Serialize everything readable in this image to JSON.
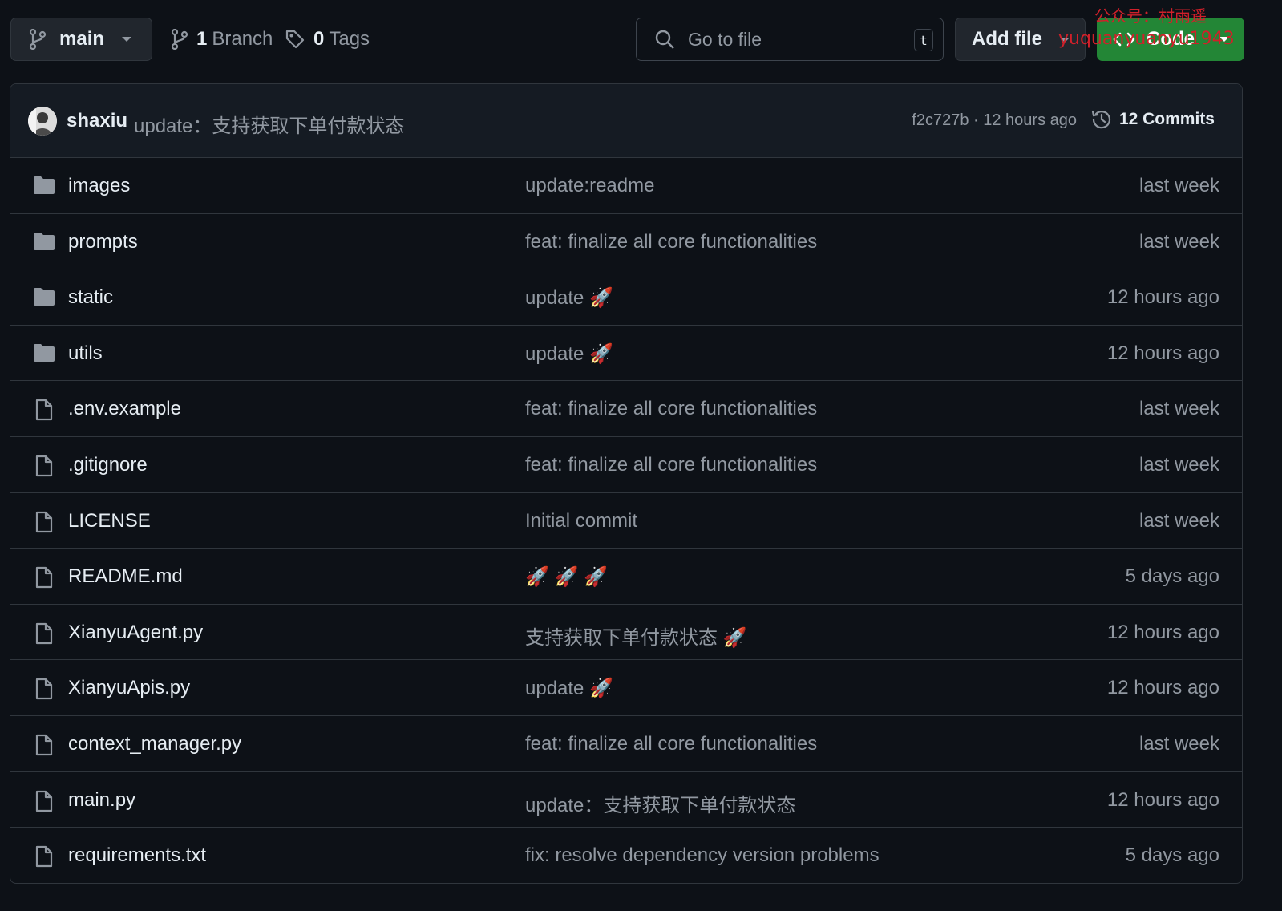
{
  "toolbar": {
    "branch_name": "main",
    "branch_count": "1",
    "branch_label": "Branch",
    "tag_count": "0",
    "tag_label": "Tags",
    "search_placeholder": "Go to file",
    "search_shortcut": "t",
    "add_file_label": "Add file",
    "code_label": "Code"
  },
  "watermark": {
    "line1": "公众号：村雨遥",
    "line2": "yuquanyuanyu1943"
  },
  "latest_commit": {
    "author": "shaxiu",
    "message": "update：支持获取下单付款状态",
    "sha_time": "f2c727b · 12 hours ago",
    "commits_label": "12 Commits"
  },
  "files": [
    {
      "name": "images",
      "type": "folder",
      "message": "update:readme",
      "age": "last week"
    },
    {
      "name": "prompts",
      "type": "folder",
      "message": "feat: finalize all core functionalities",
      "age": "last week"
    },
    {
      "name": "static",
      "type": "folder",
      "message": "update 🚀",
      "age": "12 hours ago"
    },
    {
      "name": "utils",
      "type": "folder",
      "message": "update 🚀",
      "age": "12 hours ago"
    },
    {
      "name": ".env.example",
      "type": "file",
      "message": "feat: finalize all core functionalities",
      "age": "last week"
    },
    {
      "name": ".gitignore",
      "type": "file",
      "message": "feat: finalize all core functionalities",
      "age": "last week"
    },
    {
      "name": "LICENSE",
      "type": "file",
      "message": "Initial commit",
      "age": "last week"
    },
    {
      "name": "README.md",
      "type": "file",
      "message": "🚀 🚀 🚀",
      "age": "5 days ago"
    },
    {
      "name": "XianyuAgent.py",
      "type": "file",
      "message": "支持获取下单付款状态 🚀",
      "age": "12 hours ago"
    },
    {
      "name": "XianyuApis.py",
      "type": "file",
      "message": "update 🚀",
      "age": "12 hours ago"
    },
    {
      "name": "context_manager.py",
      "type": "file",
      "message": "feat: finalize all core functionalities",
      "age": "last week"
    },
    {
      "name": "main.py",
      "type": "file",
      "message": "update：支持获取下单付款状态",
      "age": "12 hours ago"
    },
    {
      "name": "requirements.txt",
      "type": "file",
      "message": "fix: resolve dependency version problems",
      "age": "5 days ago"
    }
  ]
}
